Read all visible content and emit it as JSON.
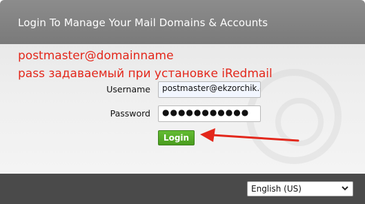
{
  "header": {
    "title": "Login To Manage Your Mail Domains & Accounts"
  },
  "annotation": {
    "line1": "postmaster@domainname",
    "line2": "pass задаваемый при установке iRedmail",
    "color": "#e3271b"
  },
  "form": {
    "username_label": "Username",
    "username_value": "postmaster@ekzorchik.c",
    "password_label": "Password",
    "password_value": "●●●●●●●●●●●",
    "login_label": "Login"
  },
  "footer": {
    "language_selected": "English (US)"
  },
  "colors": {
    "header_bg": "#808080",
    "footer_bg": "#4a4a4a",
    "login_button": "#55aa25",
    "arrow": "#e3271b"
  },
  "icons": {
    "arrow": "red-arrow-icon",
    "dropdown": "chevron-down-icon"
  }
}
